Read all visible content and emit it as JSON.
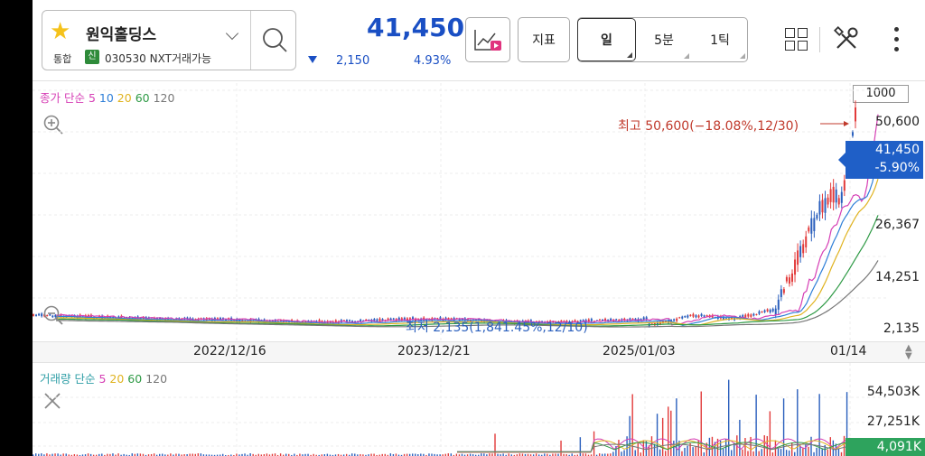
{
  "header": {
    "stock_name": "원익홀딩스",
    "market_tag": "통합",
    "new_badge": "신",
    "stock_code_line": "030530 NXT거래가능",
    "price": "41,450",
    "change": "2,150",
    "change_pct": "4.93%",
    "indicator_label": "지표",
    "periods": [
      {
        "label": "일",
        "selected": true
      },
      {
        "label": "5분",
        "selected": false
      },
      {
        "label": "1틱",
        "selected": false
      }
    ]
  },
  "price_chart": {
    "ma_prefix": "종가 단순",
    "ma_periods": [
      {
        "label": "5",
        "color": "#d63fb5"
      },
      {
        "label": "10",
        "color": "#2f7fd8"
      },
      {
        "label": "20",
        "color": "#e0b320"
      },
      {
        "label": "60",
        "color": "#2e9a45"
      },
      {
        "label": "120",
        "color": "#777777"
      }
    ],
    "candle_count_button": "1000",
    "y_ticks": [
      "50,600",
      "26,367",
      "14,251",
      "2,135"
    ],
    "current_price": "41,450",
    "current_change_pct": "-5.90%",
    "high_annotation": "최고 50,600(−18.08%,12/30)",
    "low_annotation": "최저 2,135(1,841.45%,12/10)",
    "x_ticks": [
      "2022/12/16",
      "2023/12/21",
      "2025/01/03",
      "01/14"
    ],
    "up_color": "#e23b3b",
    "down_color": "#2a5fbd"
  },
  "volume_chart": {
    "ma_prefix": "거래량 단순",
    "ma_periods": [
      {
        "label": "5",
        "color": "#d63fb5"
      },
      {
        "label": "20",
        "color": "#e0b320"
      },
      {
        "label": "60",
        "color": "#2e9a45"
      },
      {
        "label": "120",
        "color": "#777777"
      }
    ],
    "y_ticks": [
      "54,503K",
      "27,251K"
    ],
    "current_volume": "4,091K"
  }
}
